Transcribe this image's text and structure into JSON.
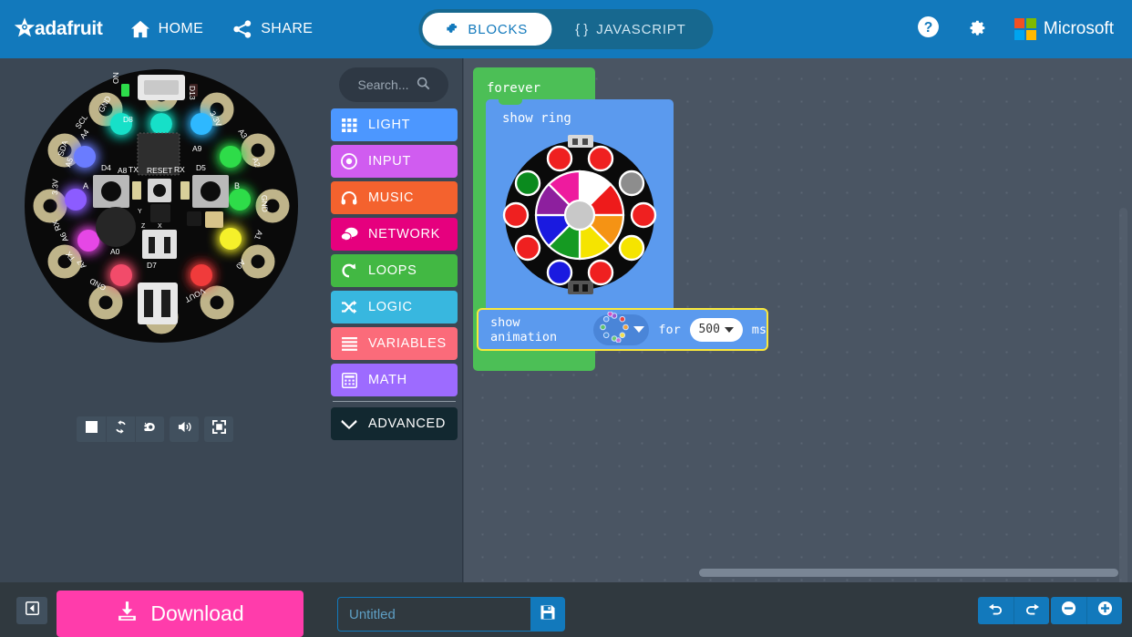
{
  "header": {
    "brand": "adafruit",
    "brand_logo_icon": "adafruit-star-icon",
    "nav": [
      {
        "label": "HOME",
        "icon": "home-icon"
      },
      {
        "label": "SHARE",
        "icon": "share-icon"
      }
    ],
    "tabs": [
      {
        "label": "BLOCKS",
        "icon": "puzzle-piece-icon",
        "active": true
      },
      {
        "label": "JAVASCRIPT",
        "icon": "curly-braces-icon",
        "active": false
      }
    ],
    "help_icon": "question-circle-icon",
    "settings_icon": "gear-icon",
    "microsoft_label": "Microsoft",
    "microsoft_icon": "microsoft-logo-icon",
    "bg_color": "#1279bc",
    "tabbar_bg_color": "#17688f"
  },
  "simulator": {
    "board_name": "circuit-playground-express",
    "pin_labels": [
      "ON",
      "GND",
      "SCL A4",
      "SDA A5",
      "3.3V",
      "RX A6",
      "TX A7",
      "GND",
      "VOUT",
      "A0",
      "A1",
      "GND",
      "A2",
      "A3",
      "3.3V",
      "D13"
    ],
    "component_labels": [
      "D8",
      "A8",
      "A9",
      "D4",
      "RESET",
      "D5",
      "TX",
      "RX",
      "A0",
      "D7",
      "GND",
      "VOUT"
    ],
    "button_labels": [
      "A",
      "B"
    ],
    "axis_labels": [
      "X",
      "Y",
      "Z"
    ],
    "neopixels": [
      {
        "index": 0,
        "color": "#18e0c8"
      },
      {
        "index": 1,
        "color": "#2fb8ff"
      },
      {
        "index": 2,
        "color": "#2ddc4a"
      },
      {
        "index": 3,
        "color": "#2ddc4a"
      },
      {
        "index": 4,
        "color": "#f5f02a"
      },
      {
        "index": 5,
        "color": "#f03a3a"
      },
      {
        "index": 6,
        "color": "#f24c6a"
      },
      {
        "index": 7,
        "color": "#e646e6"
      },
      {
        "index": 8,
        "color": "#8c5cff"
      },
      {
        "index": 9,
        "color": "#6a7cff"
      }
    ],
    "power_led_color": "#2ddc4a",
    "controls": [
      {
        "name": "stop-button",
        "icon": "stop-square-icon"
      },
      {
        "name": "restart-button",
        "icon": "refresh-icon"
      },
      {
        "name": "slow-motion-button",
        "icon": "snail-icon"
      },
      {
        "name": "mute-button",
        "icon": "speaker-icon"
      },
      {
        "name": "fullscreen-button",
        "icon": "expand-icon"
      }
    ]
  },
  "toolbox": {
    "search_placeholder": "Search...",
    "search_icon": "magnifier-icon",
    "categories": [
      {
        "label": "LIGHT",
        "color": "#4c97ff",
        "icon": "grid-icon"
      },
      {
        "label": "INPUT",
        "color": "#d05cf0",
        "icon": "target-dot-icon"
      },
      {
        "label": "MUSIC",
        "color": "#f4622e",
        "icon": "headphones-icon"
      },
      {
        "label": "NETWORK",
        "color": "#e6007e",
        "icon": "chat-bubbles-icon"
      },
      {
        "label": "LOOPS",
        "color": "#42b843",
        "icon": "loop-arrow-icon"
      },
      {
        "label": "LOGIC",
        "color": "#38b7df",
        "icon": "shuffle-icon"
      },
      {
        "label": "VARIABLES",
        "color": "#fb6b7a",
        "icon": "lines-icon"
      },
      {
        "label": "MATH",
        "color": "#9d6bff",
        "icon": "calculator-icon"
      }
    ],
    "advanced": {
      "label": "ADVANCED",
      "icon": "chevron-down-icon",
      "color": "#122830"
    }
  },
  "workspace": {
    "bg_color": "#4a5563",
    "blocks": {
      "forever": {
        "label": "forever",
        "color": "#4cbf56"
      },
      "show_ring": {
        "label": "show ring",
        "color": "#5b9aee"
      },
      "show_animation": {
        "label": "show animation",
        "for_label": "for",
        "duration_value": "500",
        "unit_label": "ms",
        "color": "#5b9aee",
        "selected": true,
        "selection_color": "#fbe83a",
        "animation_icon": "rainbow-ring-animation-icon",
        "dropdown_icon": "caret-down-icon"
      }
    },
    "ring_picker": {
      "outer_leds": [
        {
          "index": 0,
          "color": "#ef2020"
        },
        {
          "index": 1,
          "color": "#ef2020"
        },
        {
          "index": 2,
          "color": "#8d8d8d"
        },
        {
          "index": 3,
          "color": "#ef2020"
        },
        {
          "index": 4,
          "color": "#f5e400"
        },
        {
          "index": 5,
          "color": "#ef2020"
        },
        {
          "index": 6,
          "color": "#1a1ae0"
        },
        {
          "index": 7,
          "color": "#ef2020"
        },
        {
          "index": 8,
          "color": "#ef2020"
        },
        {
          "index": 9,
          "color": "#0a8a1e"
        }
      ],
      "wheel_segments": [
        "#ffffff",
        "#ee1b1b",
        "#f59314",
        "#f5e400",
        "#159a22",
        "#1a1ae0",
        "#8d1f9e",
        "#ee1b9e"
      ],
      "center_color": "#c8c8c8"
    },
    "hscrollbar": "horizontal-scrollbar",
    "vscrollbar": "vertical-scrollbar"
  },
  "footer": {
    "collapse_icon": "collapse-panel-icon",
    "download_label": "Download",
    "download_icon": "download-icon",
    "download_color": "#ff3cab",
    "project_name_value": "",
    "project_name_placeholder": "Untitled",
    "save_icon": "floppy-save-icon",
    "undo_icon": "undo-arrow-icon",
    "redo_icon": "redo-arrow-icon",
    "zoom_out_icon": "minus-circle-icon",
    "zoom_in_icon": "plus-circle-icon"
  }
}
